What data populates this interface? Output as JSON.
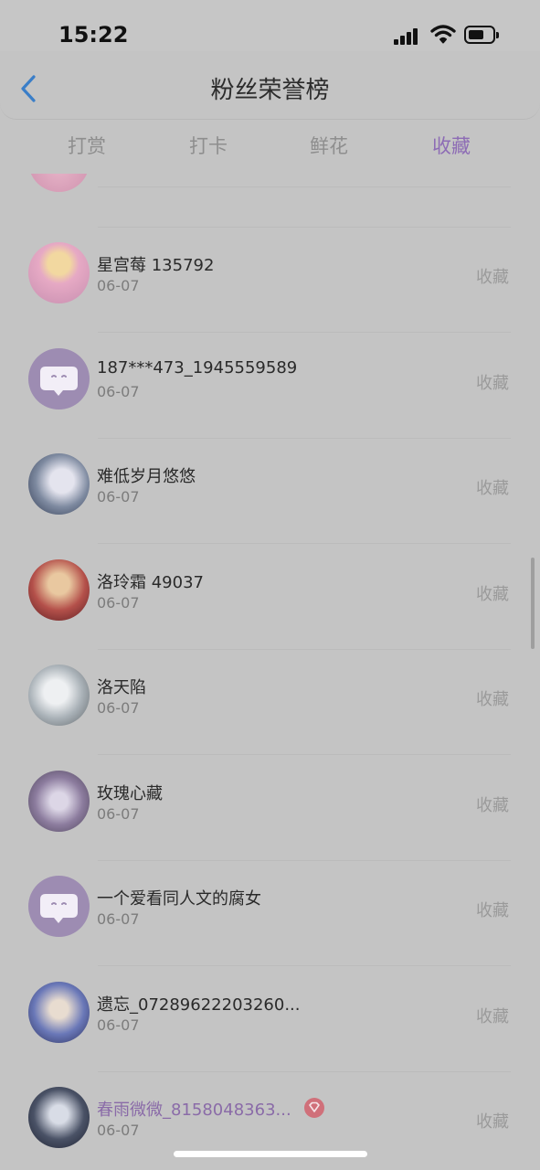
{
  "status_bar": {
    "time": "15:22"
  },
  "nav": {
    "title": "粉丝荣誉榜"
  },
  "tabs": [
    {
      "label": "打赏"
    },
    {
      "label": "打卡"
    },
    {
      "label": "鲜花"
    },
    {
      "label": "收藏",
      "active": true
    }
  ],
  "list": {
    "items": [
      {
        "name": "星宫莓 135792",
        "date": "06-07",
        "action": "收藏",
        "avatar": "anime-girl-pink"
      },
      {
        "name": "187***473_1945559589",
        "date": "06-07",
        "action": "收藏",
        "avatar": "default-chat-bubble"
      },
      {
        "name": "难低岁月悠悠",
        "date": "06-07",
        "action": "收藏",
        "avatar": "anime-girl-white"
      },
      {
        "name": "洛玲霜 49037",
        "date": "06-07",
        "action": "收藏",
        "avatar": "anime-girl-red"
      },
      {
        "name": "洛天陷",
        "date": "06-07",
        "action": "收藏",
        "avatar": "anime-girl-silver"
      },
      {
        "name": "玫瑰心藏",
        "date": "06-07",
        "action": "收藏",
        "avatar": "anime-girl-lace"
      },
      {
        "name": "一个爱看同人文的腐女",
        "date": "06-07",
        "action": "收藏",
        "avatar": "default-chat-bubble"
      },
      {
        "name": "遗忘_07289622203260...",
        "date": "06-07",
        "action": "收藏",
        "avatar": "anime-boy-blue"
      },
      {
        "name": "春雨微微_8158048363...",
        "date": "06-07",
        "action": "收藏",
        "avatar": "anime-girl-dark",
        "vip": true
      }
    ]
  },
  "colors": {
    "active_tab": "#8d6cb5",
    "vip_name": "#8a6ba8",
    "vip_badge": "#d0707a",
    "back_icon": "#3a7ec8"
  }
}
